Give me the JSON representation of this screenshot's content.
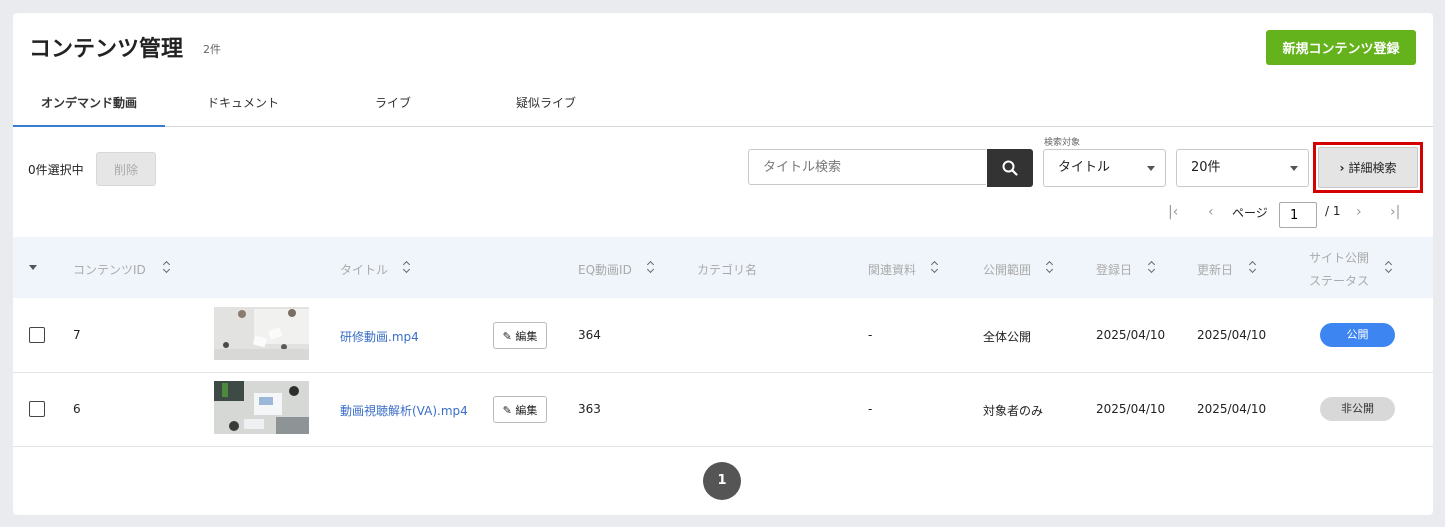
{
  "header": {
    "title": "コンテンツ管理",
    "count": "2件",
    "new_button": "新規コンテンツ登録"
  },
  "tabs": [
    {
      "label": "オンデマンド動画",
      "active": true
    },
    {
      "label": "ドキュメント",
      "active": false
    },
    {
      "label": "ライブ",
      "active": false
    },
    {
      "label": "疑似ライブ",
      "active": false
    }
  ],
  "toolbar": {
    "selection_text": "0件選択中",
    "delete_label": "削除",
    "search_placeholder": "タイトル検索",
    "search_target_label": "検索対象",
    "search_target_value": "タイトル",
    "per_page_value": "20件",
    "advanced_label": "詳細検索"
  },
  "pager": {
    "page_label": "ページ",
    "current_page": "1",
    "total_pages": "/ 1"
  },
  "table": {
    "columns": [
      "コンテンツID",
      "タイトル",
      "EQ動画ID",
      "カテゴリ名",
      "関連資料",
      "公開範囲",
      "登録日",
      "更新日",
      "サイト公開",
      "ステータス"
    ],
    "edit_label": "編集",
    "rows": [
      {
        "id": "7",
        "title": "研修動画.mp4",
        "eq_id": "364",
        "category": "",
        "materials": "-",
        "scope": "全体公開",
        "registered": "2025/04/10",
        "updated": "2025/04/10",
        "status": "公開"
      },
      {
        "id": "6",
        "title": "動画視聴解析(VA).mp4",
        "eq_id": "363",
        "category": "",
        "materials": "-",
        "scope": "対象者のみ",
        "registered": "2025/04/10",
        "updated": "2025/04/10",
        "status": "非公開"
      }
    ]
  },
  "pagination": {
    "page": "1"
  },
  "colors": {
    "accent_green": "#64b21c",
    "link_blue": "#3a6ec8",
    "badge_public": "#3d85f0",
    "badge_private": "#d8d8d8",
    "highlight_red": "#d40000"
  }
}
